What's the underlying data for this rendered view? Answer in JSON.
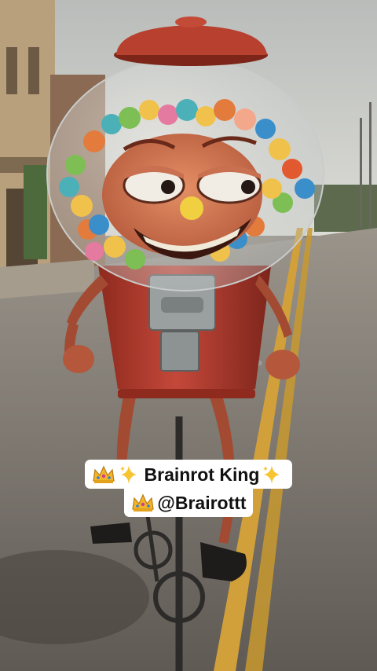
{
  "caption": {
    "line1": {
      "crown_icon": "crown-emoji",
      "sparkle_icon": "sparkles-emoji",
      "text": "Brainrot King"
    },
    "line2": {
      "crown_icon": "crown-emoji",
      "text": "@Brairottt"
    }
  },
  "colors": {
    "gumball_machine_red": "#b8402e",
    "road_asphalt": "#7d766d",
    "road_line_yellow": "#d6a53a",
    "sky": "#c9ccc9",
    "caption_background": "#ffffff"
  }
}
